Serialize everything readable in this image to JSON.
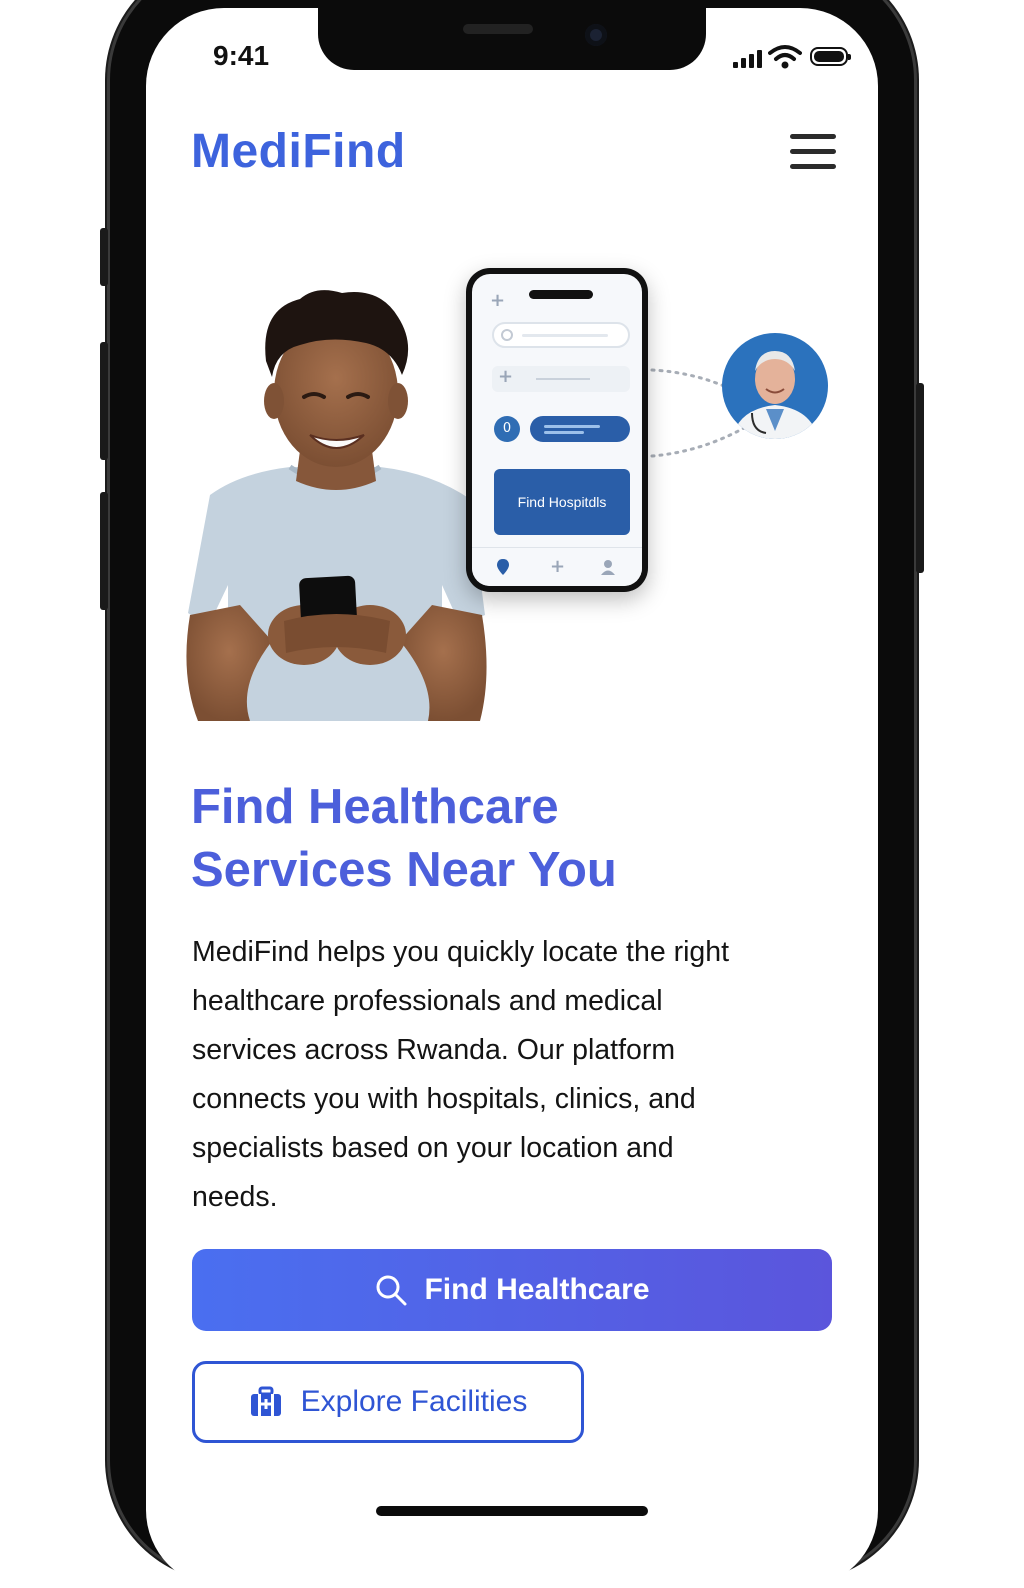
{
  "status_bar": {
    "time": "9:41"
  },
  "header": {
    "logo": "MediFind",
    "menu_icon": "hamburger-menu-icon"
  },
  "illustration": {
    "mini_app": {
      "badge_value": "0",
      "cta_label": "Find Hospitdls"
    }
  },
  "hero": {
    "headline_line1": "Find Healthcare",
    "headline_line2": "Services Near You",
    "description": [
      "MediFind helps you quickly locate the right",
      "healthcare professionals and medical",
      "services across Rwanda. Our platform",
      "connects you with hospitals, clinics, and",
      "specialists based on your location and",
      "needs."
    ]
  },
  "actions": {
    "primary_label": "Find Healthcare",
    "primary_icon": "search-icon",
    "secondary_label": "Explore Facilities",
    "secondary_icon": "hospital-icon"
  },
  "colors": {
    "brand": "#3d63dd",
    "headline": "#4c5fdb",
    "button_gradient_start": "#4a6ff0",
    "button_gradient_end": "#5b55dc",
    "outline_button": "#2f55d4"
  }
}
